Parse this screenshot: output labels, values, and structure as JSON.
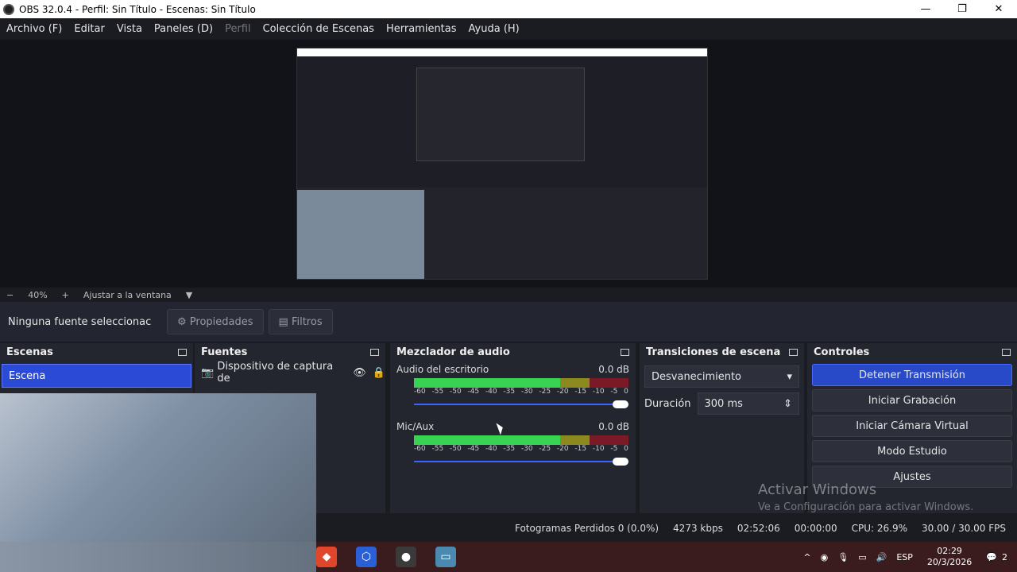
{
  "window": {
    "title": "OBS 32.0.4 - Perfil: Sin Título - Escenas: Sin Título"
  },
  "menu": [
    "Archivo (F)",
    "Editar",
    "Vista",
    "Paneles (D)",
    "Perfil",
    "Colección de Escenas",
    "Herramientas",
    "Ayuda (H)"
  ],
  "zoom": {
    "minus": "−",
    "value": "40%",
    "plus": "+",
    "fit": "Ajustar a la ventana"
  },
  "source_bar": {
    "no_selection": "Ninguna fuente seleccionac",
    "properties": "Propiedades",
    "filters": "Filtros"
  },
  "scenes": {
    "title": "Escenas",
    "items": [
      "Escena"
    ]
  },
  "sources": {
    "title": "Fuentes",
    "items": [
      "Dispositivo de captura de"
    ]
  },
  "mixer": {
    "title": "Mezclador de audio",
    "channels": [
      {
        "name": "Audio del escritorio",
        "db": "0.0 dB"
      },
      {
        "name": "Mic/Aux",
        "db": "0.0 dB"
      }
    ],
    "ticks": [
      "-60",
      "-55",
      "-50",
      "-45",
      "-40",
      "-35",
      "-30",
      "-25",
      "-20",
      "-15",
      "-10",
      "-5",
      "0"
    ]
  },
  "transitions": {
    "title": "Transiciones de escena",
    "selected": "Desvanecimiento",
    "duration_label": "Duración",
    "duration_value": "300 ms"
  },
  "controls": {
    "title": "Controles",
    "stop_stream": "Detener Transmisión",
    "start_recording": "Iniciar Grabación",
    "start_virtual_cam": "Iniciar Cámara Virtual",
    "studio_mode": "Modo Estudio",
    "settings": "Ajustes"
  },
  "status": {
    "dropped": "Fotogramas Perdidos 0 (0.0%)",
    "bitrate": "4273 kbps",
    "stream_time": "02:52:06",
    "rec_time": "00:00:00",
    "cpu": "CPU: 26.9%",
    "fps": "30.00 / 30.00 FPS"
  },
  "watermark": {
    "line1": "Activar Windows",
    "line2": "Ve a Configuración para activar Windows."
  },
  "taskbar": {
    "lang": "ESP",
    "time": "02:29",
    "date": "20/3/2026",
    "notif": "2"
  }
}
